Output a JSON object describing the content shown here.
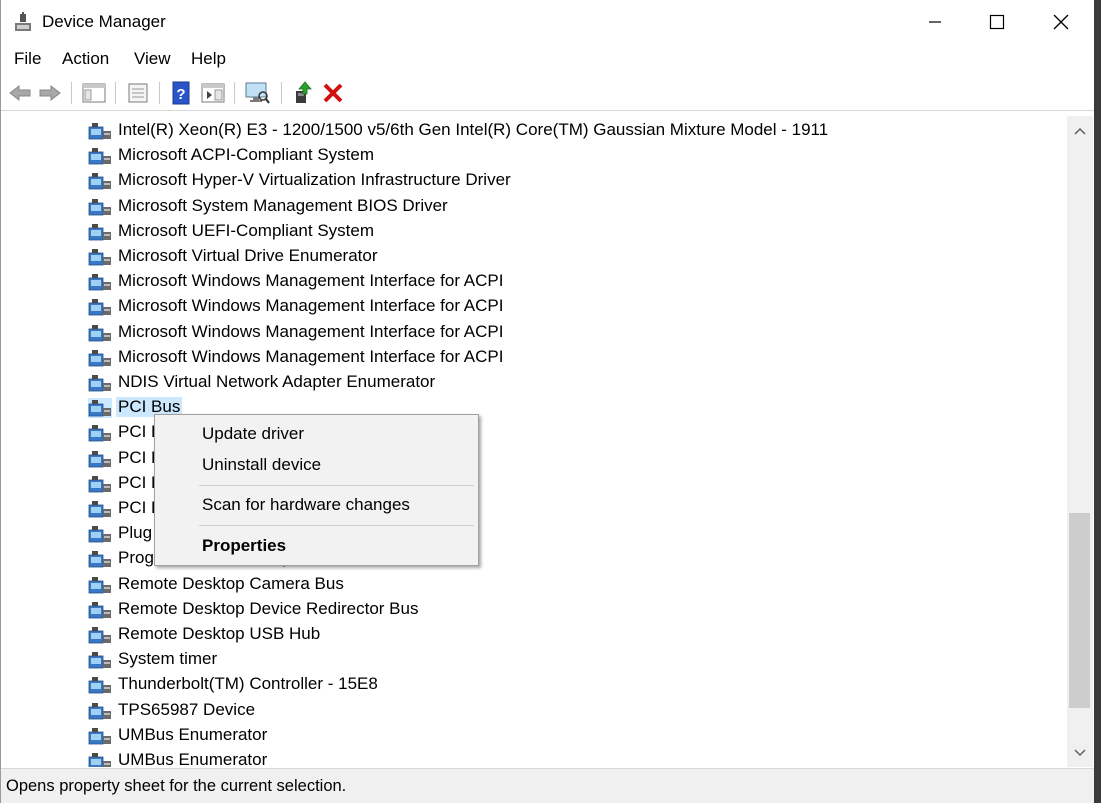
{
  "window": {
    "title": "Device Manager",
    "icon": "device-manager-icon"
  },
  "menu": {
    "items": [
      "File",
      "Action",
      "View",
      "Help"
    ]
  },
  "toolbar": {
    "buttons": [
      "back-arrow-icon",
      "forward-arrow-icon",
      "show-hide-console-tree-icon",
      "properties-icon",
      "help-icon",
      "action-pane-icon",
      "scan-hardware-icon",
      "update-driver-icon",
      "uninstall-icon"
    ]
  },
  "tree": {
    "items": [
      {
        "label": "Intel(R) Xeon(R) E3 - 1200/1500 v5/6th Gen Intel(R) Core(TM) Gaussian Mixture Model - 1911"
      },
      {
        "label": "Microsoft ACPI-Compliant System"
      },
      {
        "label": "Microsoft Hyper-V Virtualization Infrastructure Driver"
      },
      {
        "label": "Microsoft System Management BIOS Driver"
      },
      {
        "label": "Microsoft UEFI-Compliant System"
      },
      {
        "label": "Microsoft Virtual Drive Enumerator"
      },
      {
        "label": "Microsoft Windows Management Interface for ACPI"
      },
      {
        "label": "Microsoft Windows Management Interface for ACPI"
      },
      {
        "label": "Microsoft Windows Management Interface for ACPI"
      },
      {
        "label": "Microsoft Windows Management Interface for ACPI"
      },
      {
        "label": "NDIS Virtual Network Adapter Enumerator"
      },
      {
        "label": "PCI Bus",
        "selected": true
      },
      {
        "label": "PCI Bus"
      },
      {
        "label": "PCI Bus"
      },
      {
        "label": "PCI Bus"
      },
      {
        "label": "PCI Bus"
      },
      {
        "label": "Plug and Play Software Device Enumerator"
      },
      {
        "label": "Programmable interrupt controller"
      },
      {
        "label": "Remote Desktop Camera Bus"
      },
      {
        "label": "Remote Desktop Device Redirector Bus"
      },
      {
        "label": "Remote Desktop USB Hub"
      },
      {
        "label": "System timer"
      },
      {
        "label": "Thunderbolt(TM) Controller - 15E8"
      },
      {
        "label": "TPS65987 Device"
      },
      {
        "label": "UMBus Enumerator"
      },
      {
        "label": "UMBus Enumerator"
      }
    ]
  },
  "context_menu": {
    "items": [
      {
        "label": "Update driver",
        "bold": false
      },
      {
        "label": "Uninstall device",
        "bold": false
      },
      {
        "label": "Scan for hardware changes",
        "bold": false
      },
      {
        "label": "Properties",
        "bold": true
      }
    ]
  },
  "status": {
    "text": "Opens property sheet for the current selection."
  },
  "colors": {
    "selection": "#cce8ff",
    "uninstall_red": "#d21010",
    "help_blue": "#2a55c8"
  }
}
